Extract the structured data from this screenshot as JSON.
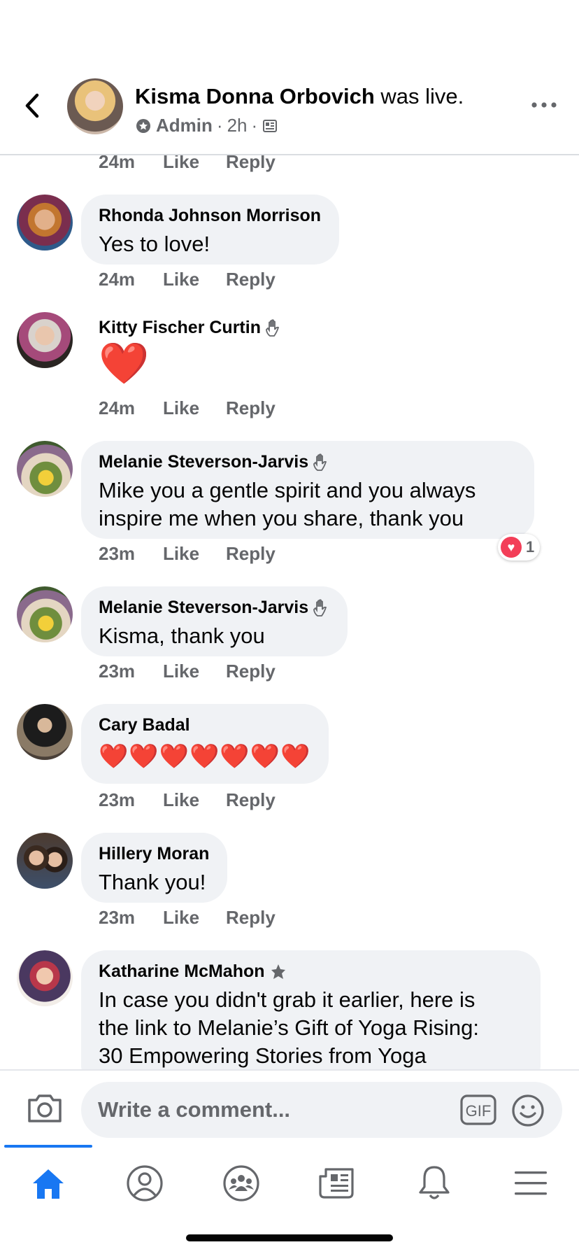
{
  "header": {
    "name": "Kisma Donna Orbovich",
    "suffix": " was live.",
    "role": "Admin",
    "time": "2h",
    "separator": "·"
  },
  "comments": [
    {
      "meta": {
        "time": "24m",
        "like": "Like",
        "reply": "Reply"
      }
    },
    {
      "author": "Rhonda Johnson Morrison",
      "text": "Yes to love!",
      "meta": {
        "time": "24m",
        "like": "Like",
        "reply": "Reply"
      }
    },
    {
      "author": "Kitty Fischer Curtin",
      "text": "❤️",
      "badge_icon": "wave-hand-icon",
      "meta": {
        "time": "24m",
        "like": "Like",
        "reply": "Reply"
      }
    },
    {
      "author": "Melanie Steverson-Jarvis",
      "text_line1": "Mike you a gentle spirit and you always",
      "text_line2": "inspire me when you share, thank you",
      "badge_icon": "wave-hand-icon",
      "reaction_count": "1",
      "meta": {
        "time": "23m",
        "like": "Like",
        "reply": "Reply"
      }
    },
    {
      "author": "Melanie Steverson-Jarvis",
      "text": "Kisma, thank you",
      "badge_icon": "wave-hand-icon",
      "meta": {
        "time": "23m",
        "like": "Like",
        "reply": "Reply"
      }
    },
    {
      "author": "Cary Badal",
      "text": "❤️❤️❤️❤️❤️❤️❤️",
      "meta": {
        "time": "23m",
        "like": "Like",
        "reply": "Reply"
      }
    },
    {
      "author": "Hillery Moran",
      "text": "Thank you!",
      "meta": {
        "time": "23m",
        "like": "Like",
        "reply": "Reply"
      }
    },
    {
      "author": "Katharine McMahon",
      "badge_icon": "star-badge-icon",
      "text_line1": "In case you didn't grab it earlier, here is",
      "text_line2": "the link to Melanie’s Gift of Yoga Rising:",
      "text_line3": "30 Empowering Stories from Yoga"
    }
  ],
  "composer": {
    "placeholder": "Write a comment...",
    "gif_label": "GIF"
  },
  "nav": {
    "items": [
      "home-icon",
      "profile-icon",
      "groups-icon",
      "news-icon",
      "notifications-icon",
      "menu-icon"
    ],
    "active": "home-icon"
  },
  "colors": {
    "accent": "#1877f2",
    "bubble": "#f0f2f5",
    "meta": "#65676b",
    "heart": "#e0242c"
  }
}
